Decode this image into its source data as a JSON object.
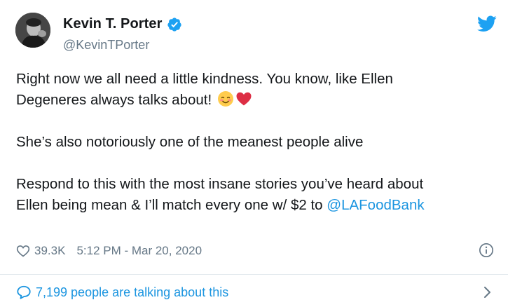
{
  "author": {
    "display_name": "Kevin T. Porter",
    "handle": "@KevinTPorter"
  },
  "icons": {
    "verified": "verified-badge-icon",
    "brand": "twitter-bird-icon",
    "like": "heart-icon",
    "info": "info-icon",
    "reply": "speech-bubble-icon",
    "more": "chevron-right-icon",
    "emoji_1": "smiling-face-emoji",
    "emoji_2": "red-heart-emoji"
  },
  "tweet": {
    "p1_line1": "Right now we all need a little kindness. You know, like Ellen",
    "p1_line2": "Degeneres always talks about!",
    "p2": "She’s also notoriously one of the meanest people alive",
    "p3_line1": "Respond to this with the most insane stories you’ve heard about",
    "p3_line2_text": "Ellen being mean & I’ll match every one w/ $2 to ",
    "p3_mention": "@LAFoodBank"
  },
  "meta": {
    "likes": "39.3K",
    "timestamp": "5:12 PM - Mar 20, 2020"
  },
  "footer": {
    "talking": "7,199 people are talking about this"
  },
  "colors": {
    "brand_blue": "#1da1f2",
    "link_blue": "#1b95e0",
    "muted": "#657786",
    "text": "#14171a"
  }
}
